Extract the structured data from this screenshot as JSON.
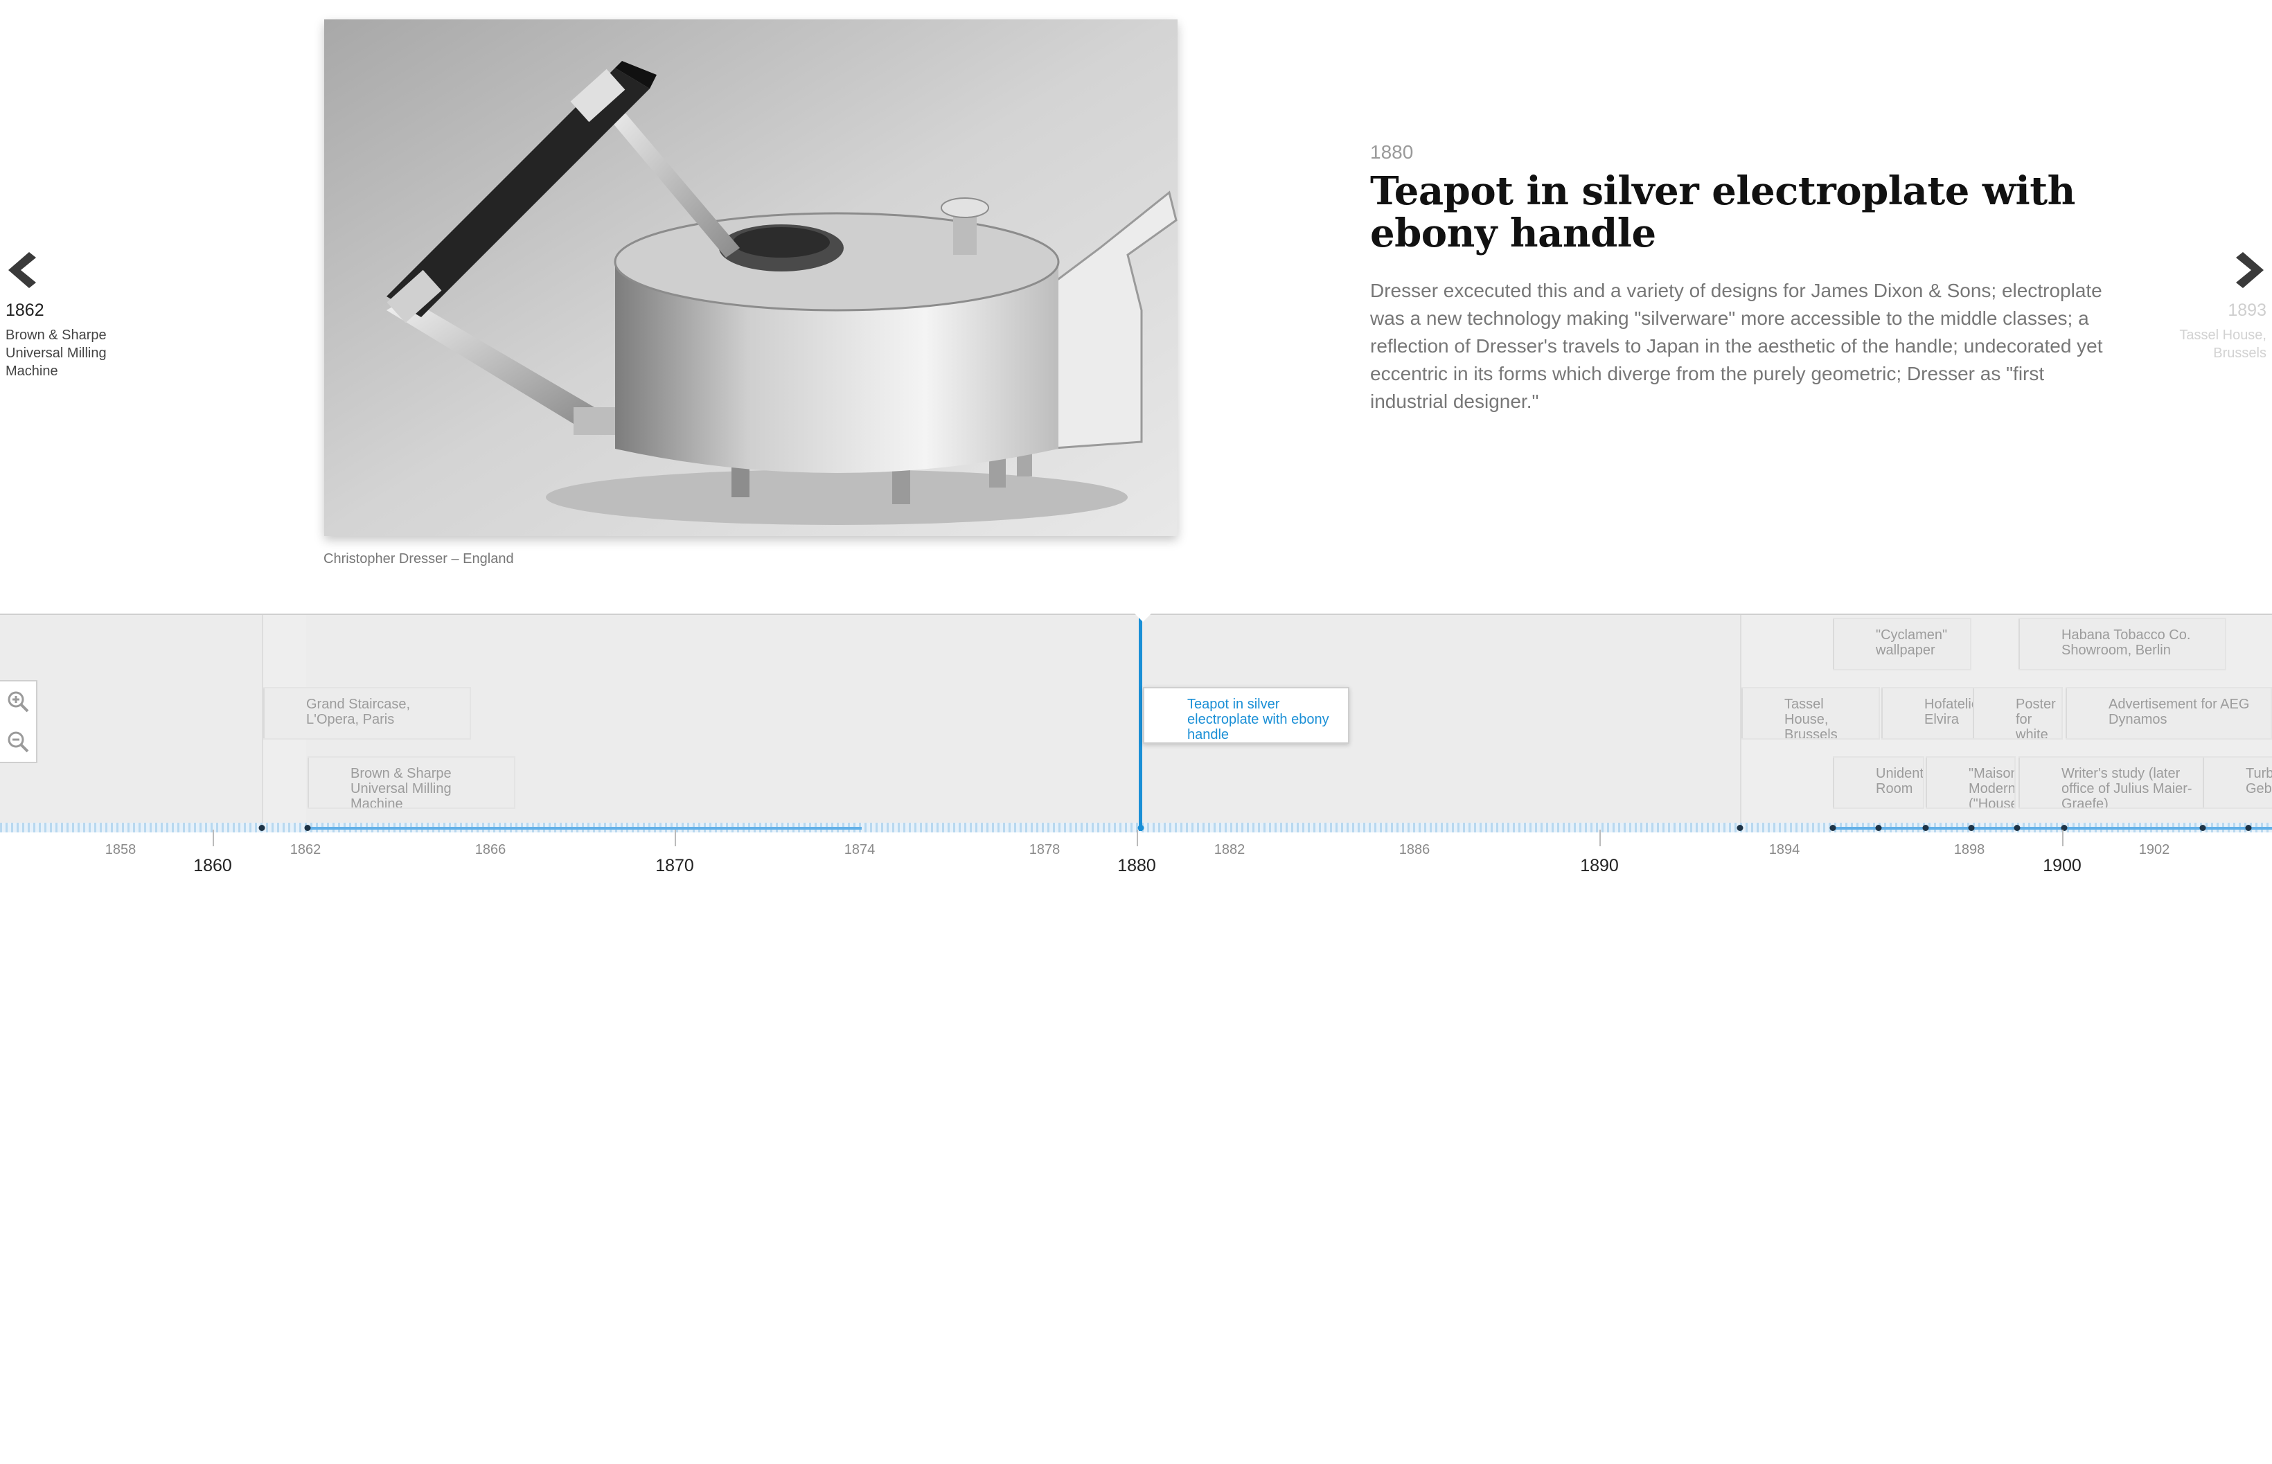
{
  "slider": {
    "prev": {
      "date": "1862",
      "title": "Brown & Sharpe Universal Milling Machine"
    },
    "next": {
      "date": "1893",
      "title": "Tassel House, Brussels"
    },
    "current": {
      "date": "1880",
      "title": "Teapot in silver electroplate with ebony handle",
      "body": "Dresser excecuted this and a variety of designs for James Dixon & Sons; electroplate was a new technology making \"silverware\" more accessible to the middle classes; a reflection of Dresser's travels to Japan in the aesthetic of the handle; undecorated yet eccentric in its forms which diverge from the purely geometric; Dresser as \"first industrial designer.\"",
      "caption": "Christopher Dresser – England"
    }
  },
  "timeline": {
    "markers": {
      "grand_staircase": "Grand Staircase, L'Opera, Paris",
      "brown_sharpe": "Brown & Sharpe Universal Milling Machine",
      "teapot": "Teapot in silver electroplate with ebony handle",
      "tassel": "Tassel House, Brussels",
      "cyclamen": "\"Cyclamen\" wallpaper",
      "habana": "Habana Tobacco Co. Showroom, Berlin",
      "hofateli": "Hofatelier Elvira",
      "poster": "Poster for white exhibition",
      "aeg": "Advertisement for AEG Dynamos",
      "unident": "Unidentified Room",
      "maison": "\"Maison Moderne\" (\"House Modern\")",
      "writer": "Writer's study (later office of Julius Maier-Graefe)",
      "tur": "Turbine Gebaude"
    },
    "axis": {
      "t1858": "1858",
      "t1860": "1860",
      "t1862": "1862",
      "t1866": "1866",
      "t1870": "1870",
      "t1874": "1874",
      "t1878": "1878",
      "t1880": "1880",
      "t1882": "1882",
      "t1886": "1886",
      "t1890": "1890",
      "t1894": "1894",
      "t1898": "1898",
      "t1900": "1900",
      "t1902": "1902"
    }
  },
  "colors": {
    "accent": "#1a8fd6",
    "dot": "#1d3346"
  }
}
